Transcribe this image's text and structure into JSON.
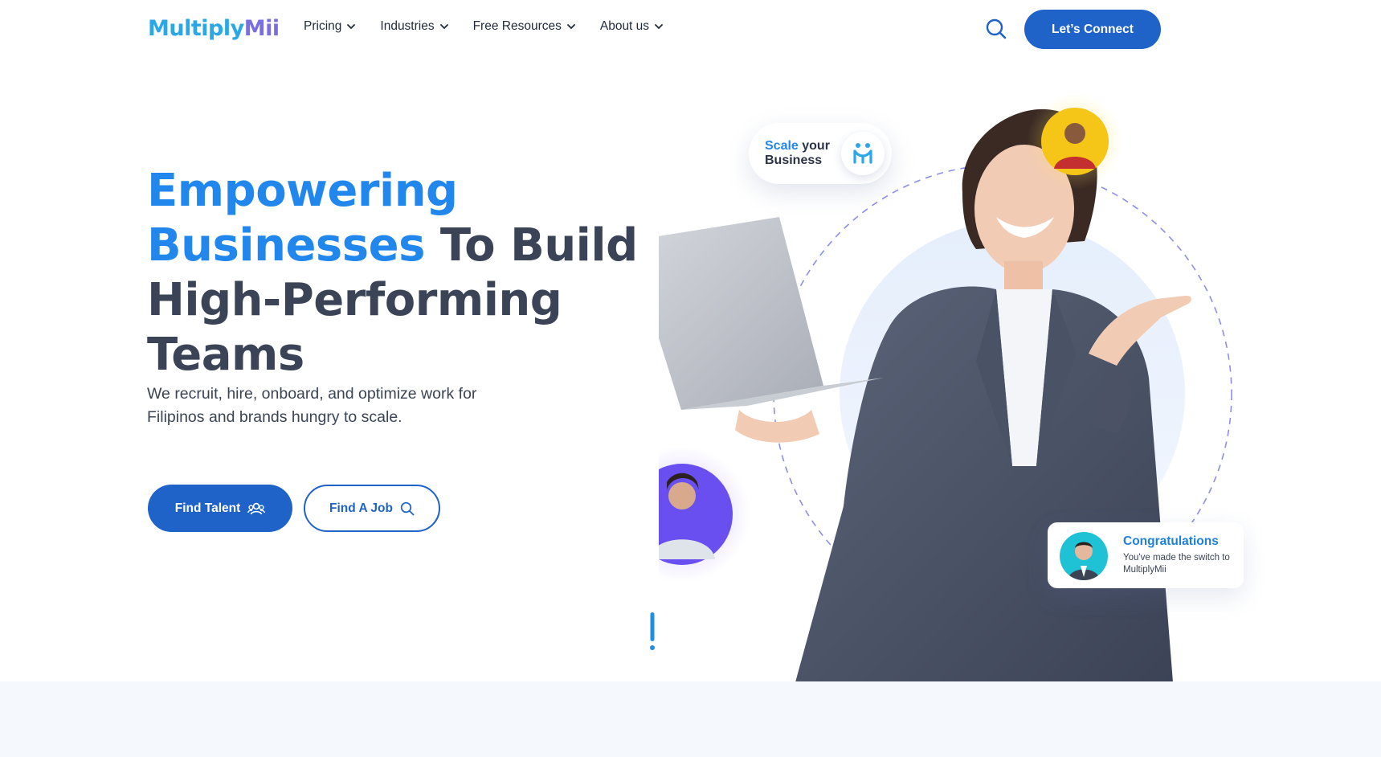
{
  "header": {
    "logo": {
      "part1": "Multiply",
      "part2": "Mii"
    },
    "nav": [
      {
        "label": "Pricing"
      },
      {
        "label": "Industries"
      },
      {
        "label": "Free Resources"
      },
      {
        "label": "About us"
      }
    ],
    "search_icon": "search-icon",
    "cta_label": "Let’s Connect"
  },
  "hero": {
    "title_hl1": "Empowering",
    "title_hl2": "Businesses",
    "title_rest1": " To Build",
    "title_rest2": "High-Performing",
    "title_rest3": "Teams",
    "subtitle": "We recruit, hire, onboard, and optimize work for Filipinos and brands hungry to scale.",
    "btn_talent": "Find Talent",
    "btn_job": "Find A Job"
  },
  "badges": {
    "scale_hl": "Scale",
    "scale_rest1": " your",
    "scale_rest2": "Business",
    "congrats_title": "Congratulations",
    "congrats_msg": "You've made the switch to MultiplyMii"
  },
  "colors": {
    "brand_blue": "#1f63c9",
    "accent_blue": "#2287ec",
    "heading_gray": "#3a4456",
    "yellow": "#f5c518",
    "purple": "#6a4ff0",
    "teal": "#1fc2d4"
  }
}
